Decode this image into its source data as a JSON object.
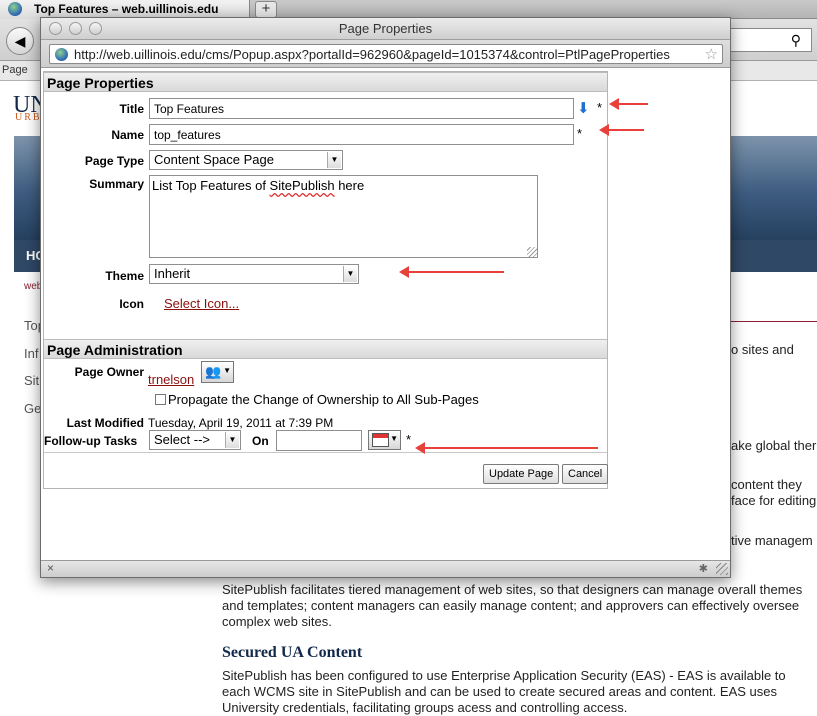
{
  "browser": {
    "tab_title": "Top Features – web.uillinois.edu",
    "new_tab": "+",
    "bookmark_item": "Page"
  },
  "background_page": {
    "logo": "UN",
    "logo_sub": "URBA",
    "nav_item": "HO",
    "breadcrumb": "web",
    "side_items": [
      "Top",
      "Inf",
      "Sit",
      "Ge"
    ],
    "fragments": [
      "o sites and",
      "ake global ther",
      "content they",
      "face for editing",
      "tive managem"
    ],
    "paragraph1": "SitePublish facilitates tiered management of web sites, so that designers can manage overall themes and templates; content managers can easily manage content; and approvers can effectively oversee complex web sites.",
    "heading": "Secured UA Content",
    "paragraph2": "SitePublish has been configured to use Enterprise Application Security (EAS) - EAS is available to each WCMS site in SitePublish and can be used to create secured areas and content. EAS uses University credentials, facilitating groups acess and controlling access."
  },
  "popup": {
    "window_title": "Page Properties",
    "url": "http://web.uillinois.edu/cms/Popup.aspx?portalId=962960&pageId=1015374&control=PtlPageProperties",
    "status_close": "×"
  },
  "form": {
    "section1_title": "Page Properties",
    "title_label": "Title",
    "title_value": "Top Features",
    "name_label": "Name",
    "name_value": "top_features",
    "page_type_label": "Page Type",
    "page_type_value": "Content Space Page",
    "summary_label": "Summary",
    "summary_prefix": "List Top Features of ",
    "summary_word": "SitePublish",
    "summary_suffix": " here",
    "theme_label": "Theme",
    "theme_value": "Inherit",
    "icon_label": "Icon",
    "icon_link": "Select Icon...",
    "section2_title": "Page Administration",
    "owner_label": "Page Owner",
    "owner_value": "trnelson",
    "propagate_label": "Propagate the Change of Ownership to All Sub-Pages",
    "modified_label": "Last Modified",
    "modified_value": "Tuesday, April 19, 2011 at 7:39 PM",
    "followup_label": "Follow-up Tasks",
    "followup_value": "Select -->",
    "on_label": "On",
    "on_value": "",
    "required_mark": "*",
    "update_button": "Update Page",
    "cancel_button": "Cancel"
  },
  "colors": {
    "annotation_arrow": "#e8403a",
    "link": "#8a1010"
  }
}
